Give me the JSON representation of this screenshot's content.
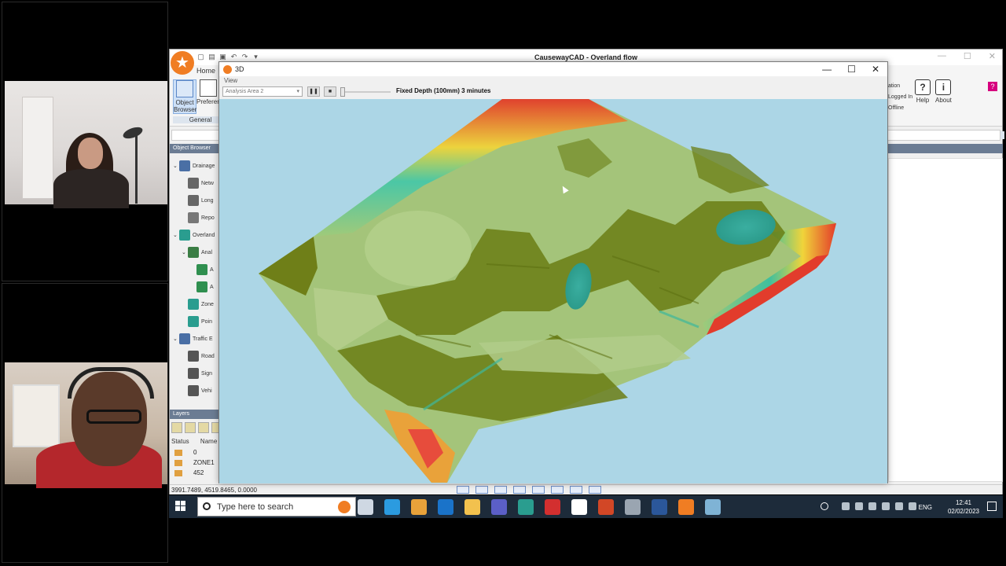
{
  "app": {
    "title": "CausewayCAD - Overland flow",
    "ribbon": {
      "tab_home": "Home",
      "object_browser": "Object Browser",
      "preferences": "Preferen",
      "group_general": "General",
      "status_lines": [
        "ation",
        "Logged In",
        "Offline"
      ],
      "help": "Help",
      "about": "About"
    },
    "object_browser_header": "Object Browser",
    "tree": [
      {
        "label": "Drainage",
        "color": "#4a6fa5",
        "indent": 0,
        "expander": "v"
      },
      {
        "label": "Netw",
        "color": "#666666",
        "indent": 1,
        "expander": ""
      },
      {
        "label": "Long",
        "color": "#666666",
        "indent": 1,
        "expander": ""
      },
      {
        "label": "Repo",
        "color": "#777777",
        "indent": 1,
        "expander": ""
      },
      {
        "label": "Overland",
        "color": "#2a9d8f",
        "indent": 0,
        "expander": "v"
      },
      {
        "label": "Anal",
        "color": "#3a7d44",
        "indent": 1,
        "expander": "v"
      },
      {
        "label": "A",
        "color": "#2f8f4f",
        "indent": 2,
        "expander": ""
      },
      {
        "label": "A",
        "color": "#2f8f4f",
        "indent": 2,
        "expander": ""
      },
      {
        "label": "Zone",
        "color": "#2a9d8f",
        "indent": 1,
        "expander": ""
      },
      {
        "label": "Poin",
        "color": "#2a9d8f",
        "indent": 1,
        "expander": ""
      },
      {
        "label": "Traffic E",
        "color": "#4a6fa5",
        "indent": 0,
        "expander": "v"
      },
      {
        "label": "Road",
        "color": "#555555",
        "indent": 1,
        "expander": ""
      },
      {
        "label": "Sign",
        "color": "#555555",
        "indent": 1,
        "expander": ""
      },
      {
        "label": "Vehi",
        "color": "#555555",
        "indent": 1,
        "expander": ""
      }
    ],
    "layers": {
      "header": "Layers",
      "col_status": "Status",
      "col_name": "Name",
      "rows": [
        "0",
        "ZONE1",
        "452"
      ]
    },
    "statusbar": "3991.7489, 4519.8465, 0.0000"
  },
  "window3d": {
    "title": "3D",
    "menu_view": "View",
    "analysis_select": "Analysis Area 2",
    "pause_label": "❚❚",
    "stop_label": "■",
    "anim_label": "Fixed Depth (100mm) 3 minutes",
    "minimize": "—",
    "maximize": "☐",
    "close": "✕"
  },
  "taskbar": {
    "search_placeholder": "Type here to search",
    "language": "ENG",
    "time": "12:41",
    "date": "02/02/2023",
    "apps": [
      {
        "name": "task-view-icon",
        "color": "#cfd8e3"
      },
      {
        "name": "edge-icon",
        "color": "#2b9be0"
      },
      {
        "name": "chrome-icon",
        "color": "#e8a23a"
      },
      {
        "name": "outlook-icon",
        "color": "#1a73c9"
      },
      {
        "name": "explorer-icon",
        "color": "#f2c14e"
      },
      {
        "name": "teams-icon",
        "color": "#5b5fc7"
      },
      {
        "name": "app-teal-icon",
        "color": "#2a9d8f"
      },
      {
        "name": "acrobat-icon",
        "color": "#d32f2f"
      },
      {
        "name": "g-app-icon",
        "color": "#ffffff"
      },
      {
        "name": "powerpoint-icon",
        "color": "#d24726"
      },
      {
        "name": "app-gray-icon",
        "color": "#9aa5b1"
      },
      {
        "name": "word-icon",
        "color": "#2b579a"
      },
      {
        "name": "causeway-icon",
        "color": "#f07d23"
      },
      {
        "name": "snowflake-icon",
        "color": "#7fb3d5"
      }
    ]
  }
}
